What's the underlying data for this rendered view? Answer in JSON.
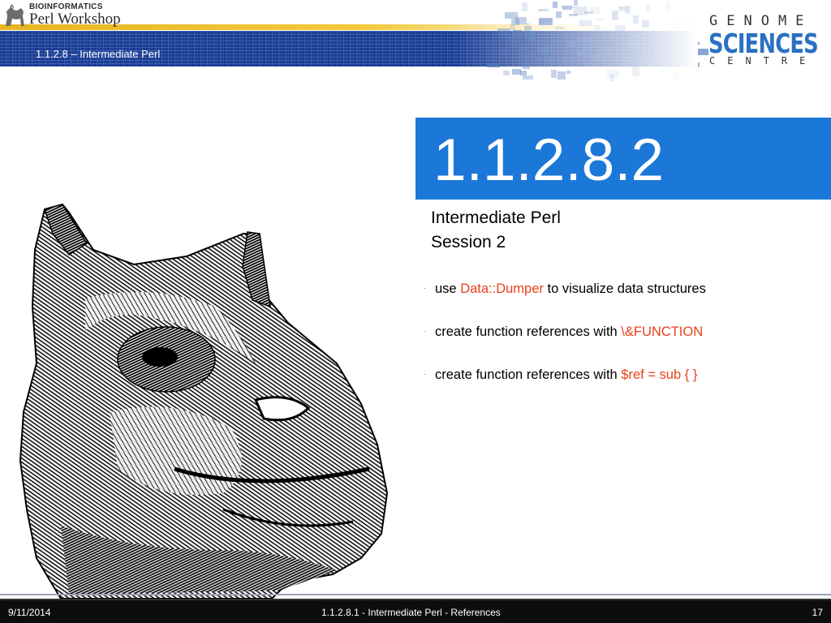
{
  "header": {
    "logo_small": "BIOINFORMATICS",
    "logo_big": "Perl Workshop",
    "title": "1.1.2.8 – Intermediate Perl",
    "brand": {
      "genome": "GENOME",
      "sciences": "SCIENCES",
      "centre": "CENTRE"
    }
  },
  "slide": {
    "number": "1.1.2.8.2",
    "subtitle_1": "Intermediate Perl",
    "subtitle_2": "Session 2",
    "bullets": [
      {
        "marker": "·",
        "pre": "use ",
        "highlight": "Data::Dumper",
        "post": " to visualize data structures"
      },
      {
        "marker": "·",
        "pre": "create function references with ",
        "highlight": "\\&FUNCTION",
        "post": ""
      },
      {
        "marker": "·",
        "pre": "create function references with ",
        "highlight": "$ref = sub { }",
        "post": ""
      }
    ]
  },
  "footer": {
    "date": "9/11/2014",
    "center": "1.1.2.8.1 - Intermediate Perl - References",
    "page": "17"
  },
  "colors": {
    "title_box": "#1b77d8",
    "highlight": "#e8401c",
    "header_band": "#1c3f95",
    "header_gold": "#f3c93a",
    "footer": "#0d0d0d"
  },
  "icons": {
    "workshop_logo": "camel-mark-icon",
    "illustration": "camel-engraving"
  }
}
